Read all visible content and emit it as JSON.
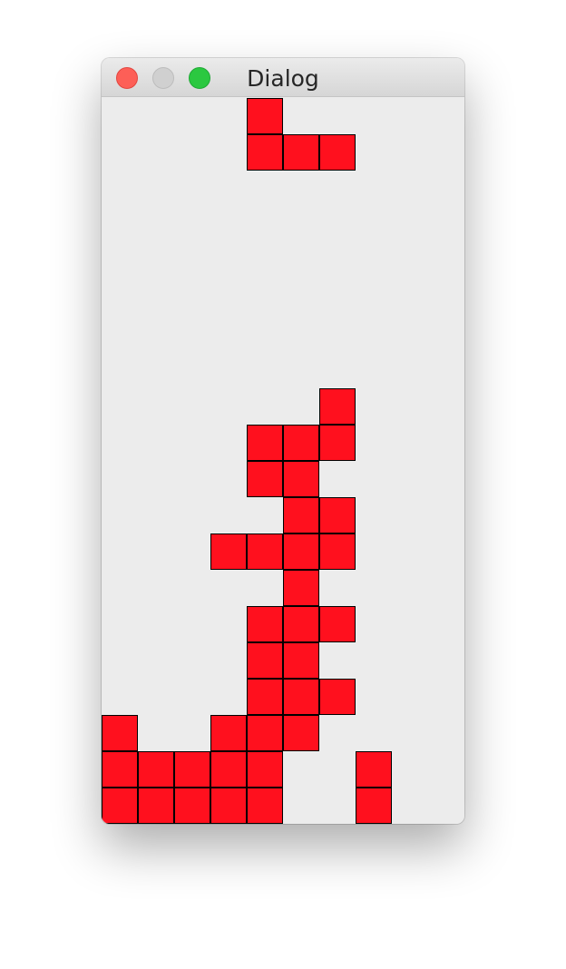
{
  "window": {
    "title": "Dialog",
    "controls": {
      "close_icon": "close-icon",
      "minimize_icon": "minimize-icon",
      "zoom_icon": "zoom-icon"
    }
  },
  "game": {
    "board_columns": 10,
    "board_rows": 20,
    "block_color": "#ff101e",
    "empty_color": "#ececec",
    "falling_piece": [
      [
        4,
        0
      ],
      [
        4,
        1
      ],
      [
        5,
        1
      ],
      [
        6,
        1
      ]
    ],
    "settled_blocks": [
      [
        6,
        8
      ],
      [
        4,
        9
      ],
      [
        5,
        9
      ],
      [
        6,
        9
      ],
      [
        4,
        10
      ],
      [
        5,
        10
      ],
      [
        5,
        11
      ],
      [
        6,
        11
      ],
      [
        3,
        12
      ],
      [
        4,
        12
      ],
      [
        5,
        12
      ],
      [
        6,
        12
      ],
      [
        5,
        13
      ],
      [
        4,
        14
      ],
      [
        5,
        14
      ],
      [
        6,
        14
      ],
      [
        4,
        15
      ],
      [
        5,
        15
      ],
      [
        4,
        16
      ],
      [
        5,
        16
      ],
      [
        6,
        16
      ],
      [
        0,
        17
      ],
      [
        3,
        17
      ],
      [
        4,
        17
      ],
      [
        5,
        17
      ],
      [
        0,
        18
      ],
      [
        1,
        18
      ],
      [
        2,
        18
      ],
      [
        3,
        18
      ],
      [
        4,
        18
      ],
      [
        7,
        18
      ],
      [
        0,
        19
      ],
      [
        1,
        19
      ],
      [
        2,
        19
      ],
      [
        3,
        19
      ],
      [
        4,
        19
      ],
      [
        7,
        19
      ]
    ]
  }
}
